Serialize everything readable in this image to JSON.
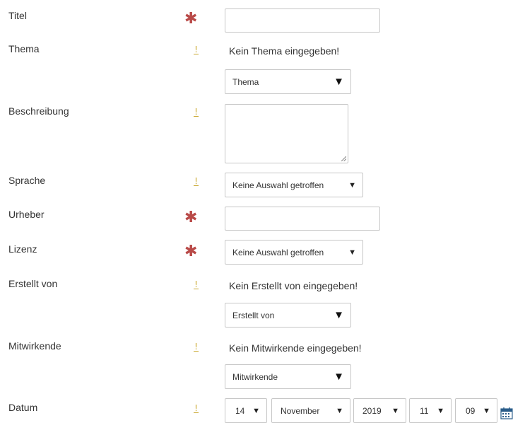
{
  "fields": {
    "titel": {
      "label": "Titel"
    },
    "thema": {
      "label": "Thema",
      "empty_message": "Kein Thema eingegeben!",
      "select_value": "Thema"
    },
    "beschreibung": {
      "label": "Beschreibung"
    },
    "sprache": {
      "label": "Sprache",
      "select_value": "Keine Auswahl getroffen"
    },
    "urheber": {
      "label": "Urheber"
    },
    "lizenz": {
      "label": "Lizenz",
      "select_value": "Keine Auswahl getroffen"
    },
    "erstellt_von": {
      "label": "Erstellt von",
      "empty_message": "Kein Erstellt von eingegeben!",
      "select_value": "Erstellt von"
    },
    "mitwirkende": {
      "label": "Mitwirkende",
      "empty_message": "Kein Mitwirkende eingegeben!",
      "select_value": "Mitwirkende"
    },
    "datum": {
      "label": "Datum",
      "day": "14",
      "month": "November",
      "year": "2019",
      "hour": "11",
      "minute": "09"
    }
  },
  "markers": {
    "required": "✱",
    "hint": "!"
  },
  "icons": {
    "required": "asterisk-icon",
    "hint": "exclamation-icon",
    "dropdown": "caret-down-icon",
    "calendar": "calendar-icon"
  },
  "colors": {
    "required": "#b94a48",
    "hint": "#c9a830",
    "border": "#c6c6c6",
    "text": "#333333"
  }
}
